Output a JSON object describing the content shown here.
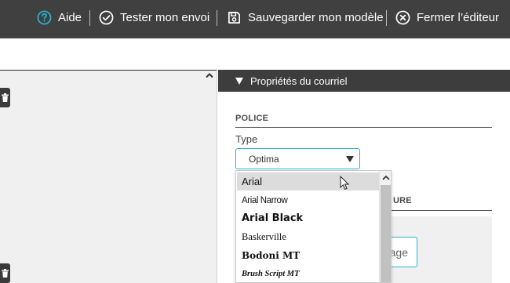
{
  "toolbar": {
    "items": [
      {
        "label": "Aide",
        "icon": "question-circle-icon"
      },
      {
        "label": "Tester mon envoi",
        "icon": "check-circle-icon"
      },
      {
        "label": "Sauvegarder mon modèle",
        "icon": "save-icon"
      },
      {
        "label": "Fermer l’éditeur",
        "icon": "close-circle-icon"
      }
    ],
    "colors": {
      "background": "#404040",
      "accent": "#2ab3cf"
    }
  },
  "panel": {
    "title": "Propriétés du courriel",
    "font_section": {
      "title": "POLICE",
      "type_label": "Type",
      "selected": "Optima"
    },
    "second_section_title_partial": "URE",
    "image_button_partial": "age"
  },
  "font_dropdown": {
    "options": [
      "Arial",
      "Arial Narrow",
      "Arial Black",
      "Baskerville",
      "Bodoni MT",
      "Brush Script MT"
    ],
    "highlighted": "Arial"
  }
}
